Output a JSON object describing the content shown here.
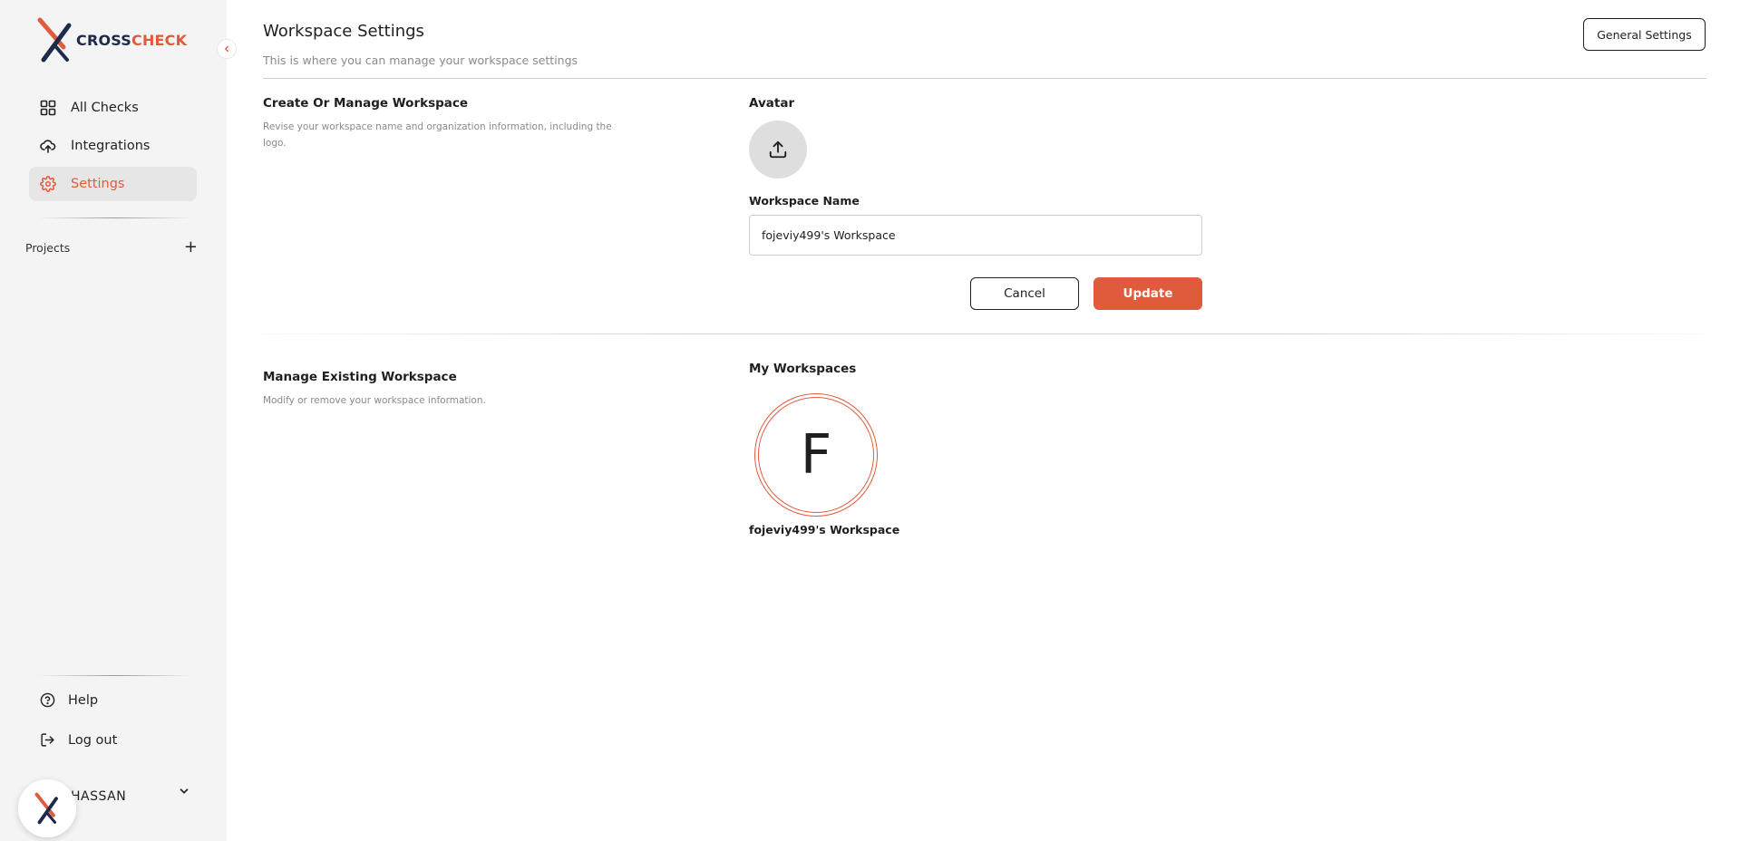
{
  "brand": {
    "name_part1": "CROSS",
    "name_part2": "CHECK",
    "accent_color": "#e05a3c",
    "dark_color": "#1e2a4a"
  },
  "sidebar": {
    "items": [
      {
        "label": "All Checks",
        "icon": "grid-icon",
        "active": false
      },
      {
        "label": "Integrations",
        "icon": "cloud-upload-icon",
        "active": false
      },
      {
        "label": "Settings",
        "icon": "gear-icon",
        "active": true
      }
    ],
    "projects_label": "Projects",
    "projects_add": "+",
    "bottom": [
      {
        "label": "Help",
        "icon": "help-circle-icon"
      },
      {
        "label": "Log out",
        "icon": "logout-icon"
      }
    ],
    "user_name": "HASSAN"
  },
  "header": {
    "title": "Workspace Settings",
    "subtitle": "This is where you can manage your workspace settings",
    "general_settings_label": "General Settings"
  },
  "create_section": {
    "title": "Create Or Manage Workspace",
    "description": "Revise your workspace name and organization information, including the logo.",
    "avatar_label": "Avatar",
    "name_label": "Workspace Name",
    "name_value": "fojeviy499's Workspace",
    "cancel_label": "Cancel",
    "update_label": "Update"
  },
  "manage_section": {
    "title": "Manage Existing Workspace",
    "description": "Modify or remove your workspace information.",
    "my_workspaces_label": "My Workspaces",
    "workspaces": [
      {
        "initial": "F",
        "name": "fojeviy499's Workspace"
      }
    ]
  }
}
